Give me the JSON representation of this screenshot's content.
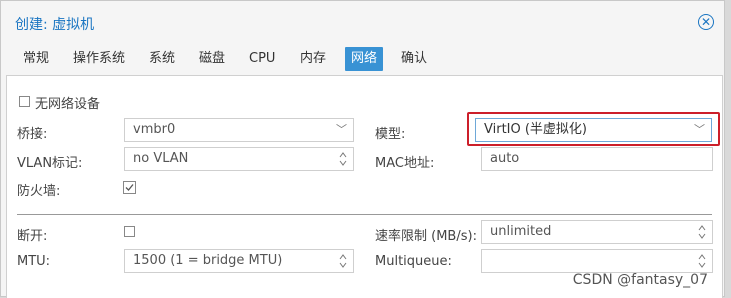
{
  "dialog": {
    "title": "创建: 虚拟机",
    "tabs": [
      "常规",
      "操作系统",
      "系统",
      "磁盘",
      "CPU",
      "内存",
      "网络",
      "确认"
    ],
    "active_tab": "网络"
  },
  "form": {
    "no_network_label": "无网络设备",
    "bridge": {
      "label": "桥接:",
      "value": "vmbr0"
    },
    "vlan": {
      "label": "VLAN标记:",
      "value": "no VLAN"
    },
    "firewall": {
      "label": "防火墙:",
      "checked": true
    },
    "model": {
      "label": "模型:",
      "value": "VirtIO (半虚拟化)"
    },
    "mac": {
      "label": "MAC地址:",
      "value": "auto"
    },
    "disconnect": {
      "label": "断开:",
      "checked": false
    },
    "mtu": {
      "label": "MTU:",
      "value": "1500 (1 = bridge MTU)"
    },
    "rate_limit": {
      "label": "速率限制 (MB/s):",
      "value": "unlimited"
    },
    "multiqueue": {
      "label": "Multiqueue:",
      "value": ""
    }
  },
  "watermark": "CSDN @fantasy_07",
  "colors": {
    "accent": "#3892d4",
    "title": "#1a75c2",
    "highlight": "#cc1f2a"
  }
}
